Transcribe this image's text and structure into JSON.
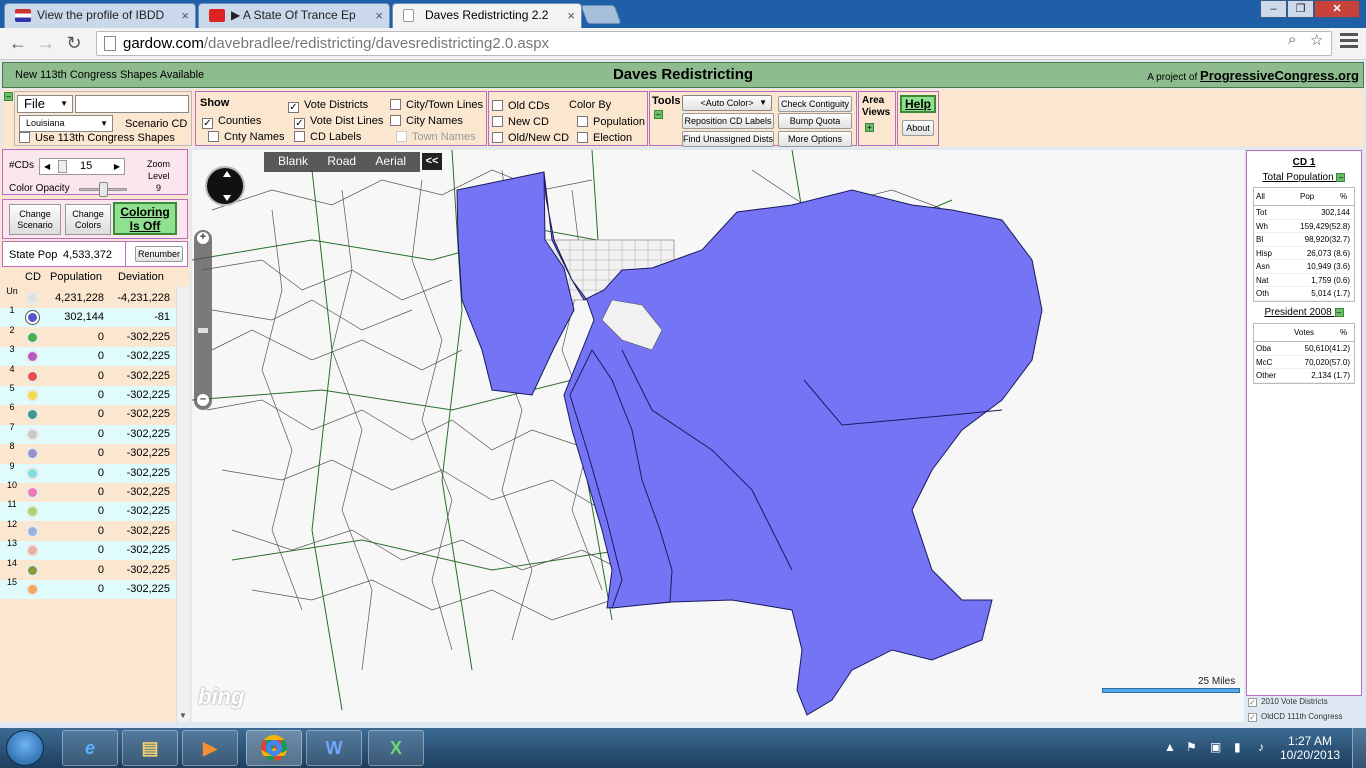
{
  "browser": {
    "tabs": [
      {
        "label": "View the profile of IBDD"
      },
      {
        "label": "▶ A State Of Trance Ep"
      },
      {
        "label": "Daves Redistricting 2.2"
      }
    ],
    "url_host": "gardow.com",
    "url_path": "/davebradlee/redistricting/davesredistricting2.0.aspx"
  },
  "header": {
    "notice": "New 113th Congress Shapes Available",
    "title": "Daves Redistricting",
    "project_prefix": "A project of",
    "project_link": "ProgressiveCongress.org"
  },
  "toolbar": {
    "file_label": "File",
    "state_value": "Louisiana",
    "scenario_label": "Scenario CD",
    "use_113_label": "Use 113th Congress Shapes",
    "show_label": "Show",
    "counties_label": "Counties",
    "cnty_names_label": "Cnty Names",
    "vote_districts_label": "Vote Districts",
    "vote_dist_lines_label": "Vote Dist Lines",
    "cd_labels_label": "CD Labels",
    "city_town_lines_label": "City/Town Lines",
    "city_names_label": "City Names",
    "town_names_label": "Town Names",
    "old_cds_label": "Old CDs",
    "new_cd_label": "New CD",
    "old_new_cd_label": "Old/New CD",
    "color_by_label": "Color By",
    "population_label": "Population",
    "election_label": "Election",
    "tools_label": "Tools",
    "auto_color_value": "<Auto Color>",
    "check_contiguity_label": "Check Contiguity",
    "reposition_cd_labels_label": "Reposition CD Labels",
    "bump_quota_label": "Bump Quota",
    "find_unassigned_label": "Find Unassigned Dists",
    "more_options_label": "More Options",
    "area_label": "Area",
    "views_label": "Views",
    "help_label": "Help",
    "about_label": "About"
  },
  "leftpanel": {
    "cds_label": "#CDs",
    "cds_value": "15",
    "zoom_label": "Zoom",
    "zoom_level_label": "Level",
    "zoom_value": "9",
    "color_opacity_label": "Color Opacity",
    "change_scenario_line1": "Change",
    "change_scenario_line2": "Scenario",
    "change_colors_line1": "Change",
    "change_colors_line2": "Colors",
    "coloring_line1": "Coloring",
    "coloring_line2": "Is Off",
    "state_pop_label": "State Pop",
    "state_pop_value": "4,533,372",
    "renumber_label": "Renumber",
    "col_cd": "CD",
    "col_population": "Population",
    "col_deviation": "Deviation",
    "rows": [
      {
        "cd": "Un",
        "pop": "4,231,228",
        "dev": "-4,231,228",
        "color": "#e0e0e0",
        "bg": "#fbe6d0"
      },
      {
        "cd": "1",
        "pop": "302,144",
        "dev": "-81",
        "color": "#5555cc",
        "bg": "#e0fbfb"
      },
      {
        "cd": "2",
        "pop": "0",
        "dev": "-302,225",
        "color": "#4caf50",
        "bg": "#fbe6d0"
      },
      {
        "cd": "3",
        "pop": "0",
        "dev": "-302,225",
        "color": "#b35cc0",
        "bg": "#e0fbfb"
      },
      {
        "cd": "4",
        "pop": "0",
        "dev": "-302,225",
        "color": "#ef4d4d",
        "bg": "#fbe6d0"
      },
      {
        "cd": "5",
        "pop": "0",
        "dev": "-302,225",
        "color": "#f5d84a",
        "bg": "#e0fbfb"
      },
      {
        "cd": "6",
        "pop": "0",
        "dev": "-302,225",
        "color": "#3e9a8a",
        "bg": "#fbe6d0"
      },
      {
        "cd": "7",
        "pop": "0",
        "dev": "-302,225",
        "color": "#c8c8c8",
        "bg": "#e0fbfb"
      },
      {
        "cd": "8",
        "pop": "0",
        "dev": "-302,225",
        "color": "#9a8fc9",
        "bg": "#fbe6d0"
      },
      {
        "cd": "9",
        "pop": "0",
        "dev": "-302,225",
        "color": "#7fe0e0",
        "bg": "#e0fbfb"
      },
      {
        "cd": "10",
        "pop": "0",
        "dev": "-302,225",
        "color": "#f07ab8",
        "bg": "#fbe6d0"
      },
      {
        "cd": "11",
        "pop": "0",
        "dev": "-302,225",
        "color": "#a4d86a",
        "bg": "#e0fbfb"
      },
      {
        "cd": "12",
        "pop": "0",
        "dev": "-302,225",
        "color": "#9ab4e0",
        "bg": "#fbe6d0"
      },
      {
        "cd": "13",
        "pop": "0",
        "dev": "-302,225",
        "color": "#e6b0a8",
        "bg": "#e0fbfb"
      },
      {
        "cd": "14",
        "pop": "0",
        "dev": "-302,225",
        "color": "#8a9a3a",
        "bg": "#fbe6d0"
      },
      {
        "cd": "15",
        "pop": "0",
        "dev": "-302,225",
        "color": "#f0a860",
        "bg": "#e0fbfb"
      }
    ]
  },
  "map": {
    "types": [
      "Blank",
      "Road",
      "Aerial"
    ],
    "collapse_label": "<<",
    "scale_label": "25 Miles",
    "bing_label": "bing",
    "district_color": "#7474f4"
  },
  "rightpanel": {
    "cd_title": "CD 1",
    "total_pop_title": "Total Population",
    "pop_head": [
      "All",
      "Pop",
      "%"
    ],
    "pop_rows": [
      {
        "k": "Tot",
        "v": "302,144"
      },
      {
        "k": "Wh",
        "v": "159,429(52.8)"
      },
      {
        "k": "Bl",
        "v": "98,920(32.7)"
      },
      {
        "k": "Hisp",
        "v": "26,073 (8.6)"
      },
      {
        "k": "Asn",
        "v": "10,949 (3.6)"
      },
      {
        "k": "Nat",
        "v": "1,759 (0.6)"
      },
      {
        "k": "Oth",
        "v": "5,014 (1.7)"
      }
    ],
    "pres_title": "President 2008",
    "pres_head": [
      "Votes",
      "%"
    ],
    "pres_rows": [
      {
        "k": "Oba",
        "v": "50,610(41.2)"
      },
      {
        "k": "McC",
        "v": "70,020(57.0)"
      },
      {
        "k": "Other",
        "v": "2,134 (1.7)"
      }
    ],
    "legend_2010": "2010 Vote Districts",
    "legend_old": "OldCD 111th Congress"
  },
  "taskbar": {
    "time": "1:27 AM",
    "date": "10/20/2013"
  }
}
